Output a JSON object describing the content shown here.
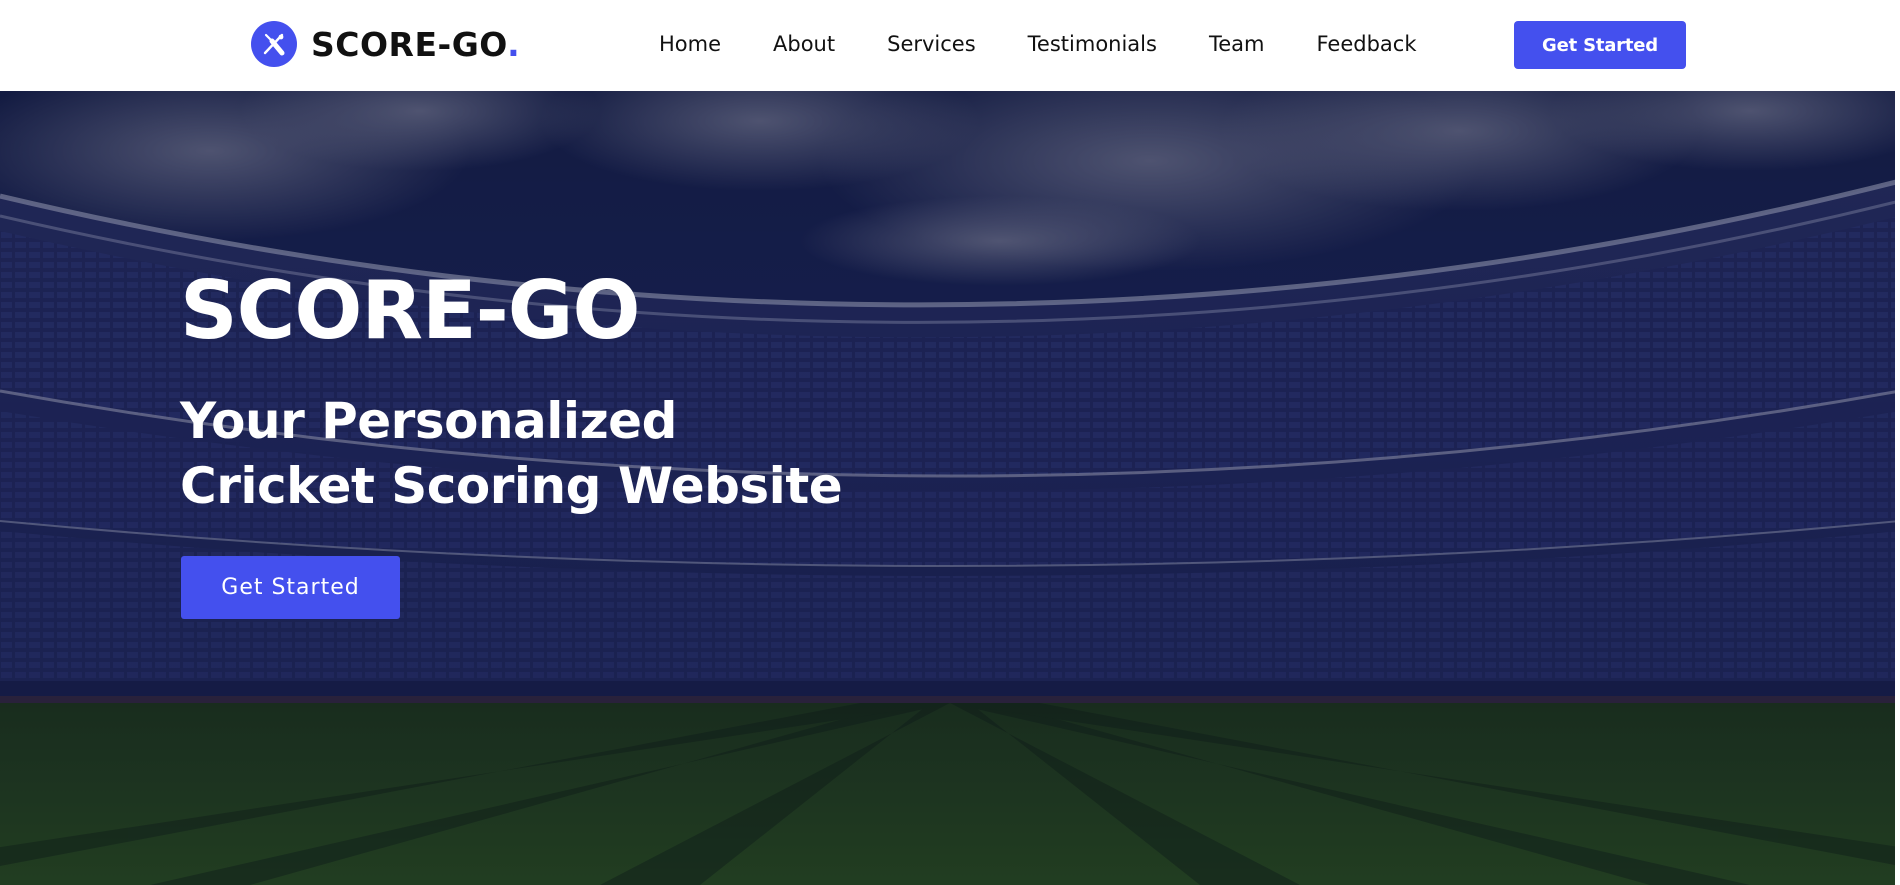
{
  "brand": {
    "name": "SCORE-GO",
    "dot": ".",
    "icon": "cricket-bat-icon"
  },
  "nav": {
    "items": [
      {
        "label": "Home"
      },
      {
        "label": "About"
      },
      {
        "label": "Services"
      },
      {
        "label": "Testimonials"
      },
      {
        "label": "Team"
      },
      {
        "label": "Feedback"
      }
    ]
  },
  "header": {
    "cta_label": "Get Started"
  },
  "hero": {
    "title": "SCORE-GO",
    "subtitle": "Your Personalized Cricket Scoring Website",
    "cta_label": "Get Started",
    "background": "cricket-stadium-image"
  },
  "colors": {
    "accent": "#4450ee",
    "text_dark": "#111111",
    "text_light": "#ffffff"
  }
}
